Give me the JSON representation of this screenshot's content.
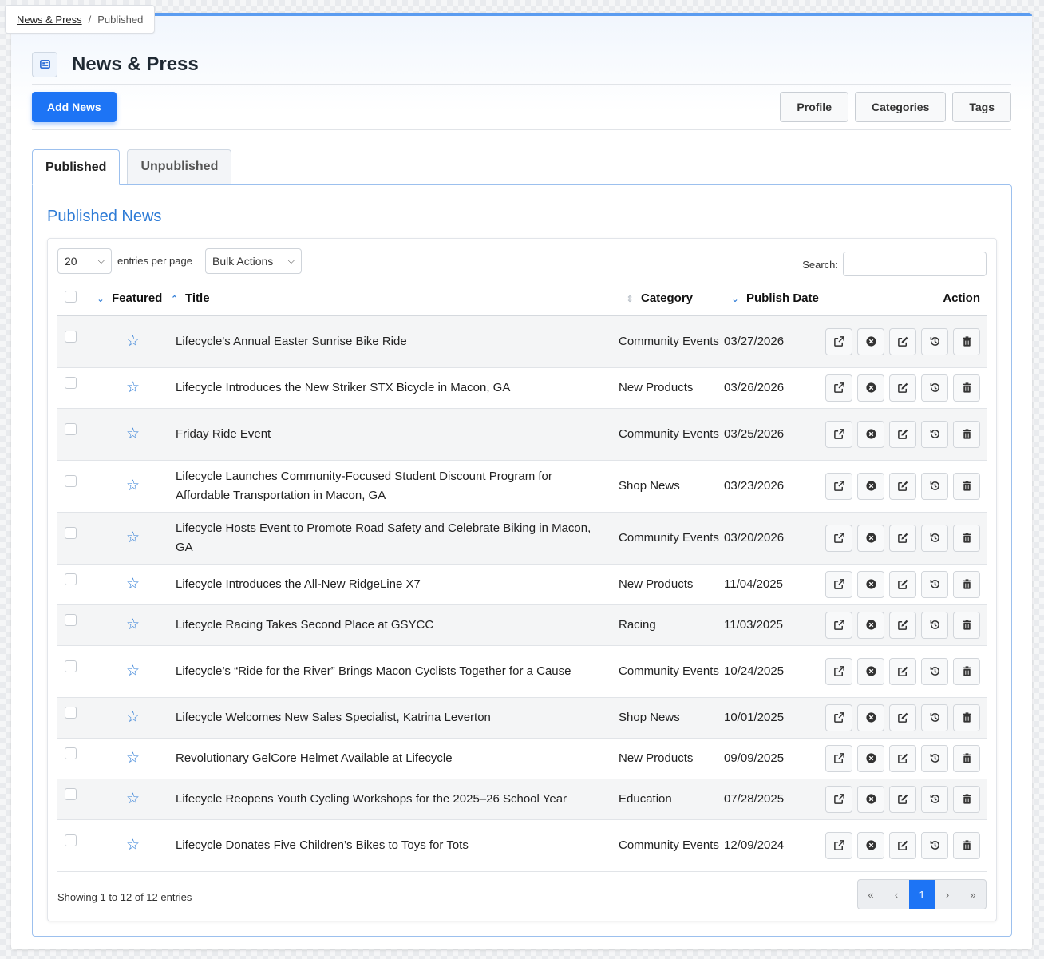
{
  "breadcrumb": {
    "parent": "News & Press",
    "separator": "/",
    "current": "Published"
  },
  "page": {
    "title": "News & Press",
    "icon": "newspaper-icon"
  },
  "toolbar": {
    "add_label": "Add News",
    "profile_label": "Profile",
    "categories_label": "Categories",
    "tags_label": "Tags"
  },
  "tabs": [
    {
      "label": "Published",
      "active": true
    },
    {
      "label": "Unpublished",
      "active": false
    }
  ],
  "panel": {
    "title": "Published News"
  },
  "controls": {
    "per_page_value": "20",
    "per_page_label": "entries per page",
    "bulk_label": "Bulk Actions",
    "search_label": "Search:",
    "search_value": ""
  },
  "columns": {
    "featured": "Featured",
    "title": "Title",
    "category": "Category",
    "date": "Publish Date",
    "action": "Action"
  },
  "rows": [
    {
      "title": "Lifecycle's Annual Easter Sunrise Bike Ride",
      "category": "Community Events",
      "date": "03/27/2026"
    },
    {
      "title": "Lifecycle Introduces the New Striker STX Bicycle in Macon, GA",
      "category": "New Products",
      "date": "03/26/2026"
    },
    {
      "title": "Friday Ride Event",
      "category": "Community Events",
      "date": "03/25/2026"
    },
    {
      "title": "Lifecycle Launches Community-Focused Student Discount Program for Affordable Transportation in Macon, GA",
      "category": "Shop News",
      "date": "03/23/2026"
    },
    {
      "title": "Lifecycle Hosts Event to Promote Road Safety and Celebrate Biking in Macon, GA",
      "category": "Community Events",
      "date": "03/20/2026"
    },
    {
      "title": "Lifecycle Introduces the All-New RidgeLine X7",
      "category": "New Products",
      "date": "11/04/2025"
    },
    {
      "title": "Lifecycle Racing Takes Second Place at GSYCC",
      "category": "Racing",
      "date": "11/03/2025"
    },
    {
      "title": "Lifecycle’s “Ride for the River” Brings Macon Cyclists Together for a Cause",
      "category": "Community Events",
      "date": "10/24/2025"
    },
    {
      "title": "Lifecycle Welcomes New Sales Specialist, Katrina Leverton",
      "category": "Shop News",
      "date": "10/01/2025"
    },
    {
      "title": "Revolutionary GelCore Helmet Available at Lifecycle",
      "category": "New Products",
      "date": "09/09/2025"
    },
    {
      "title": "Lifecycle Reopens Youth Cycling Workshops for the 2025–26 School Year",
      "category": "Education",
      "date": "07/28/2025"
    },
    {
      "title": "Lifecycle Donates Five Children’s Bikes to Toys for Tots",
      "category": "Community Events",
      "date": "12/09/2024"
    }
  ],
  "footer": {
    "info": "Showing 1 to 12 of 12 entries",
    "pages": [
      "«",
      "‹",
      "1",
      "›",
      "»"
    ],
    "current_page": "1"
  },
  "colors": {
    "accent": "#1d74f5",
    "link": "#2d7bd6"
  }
}
